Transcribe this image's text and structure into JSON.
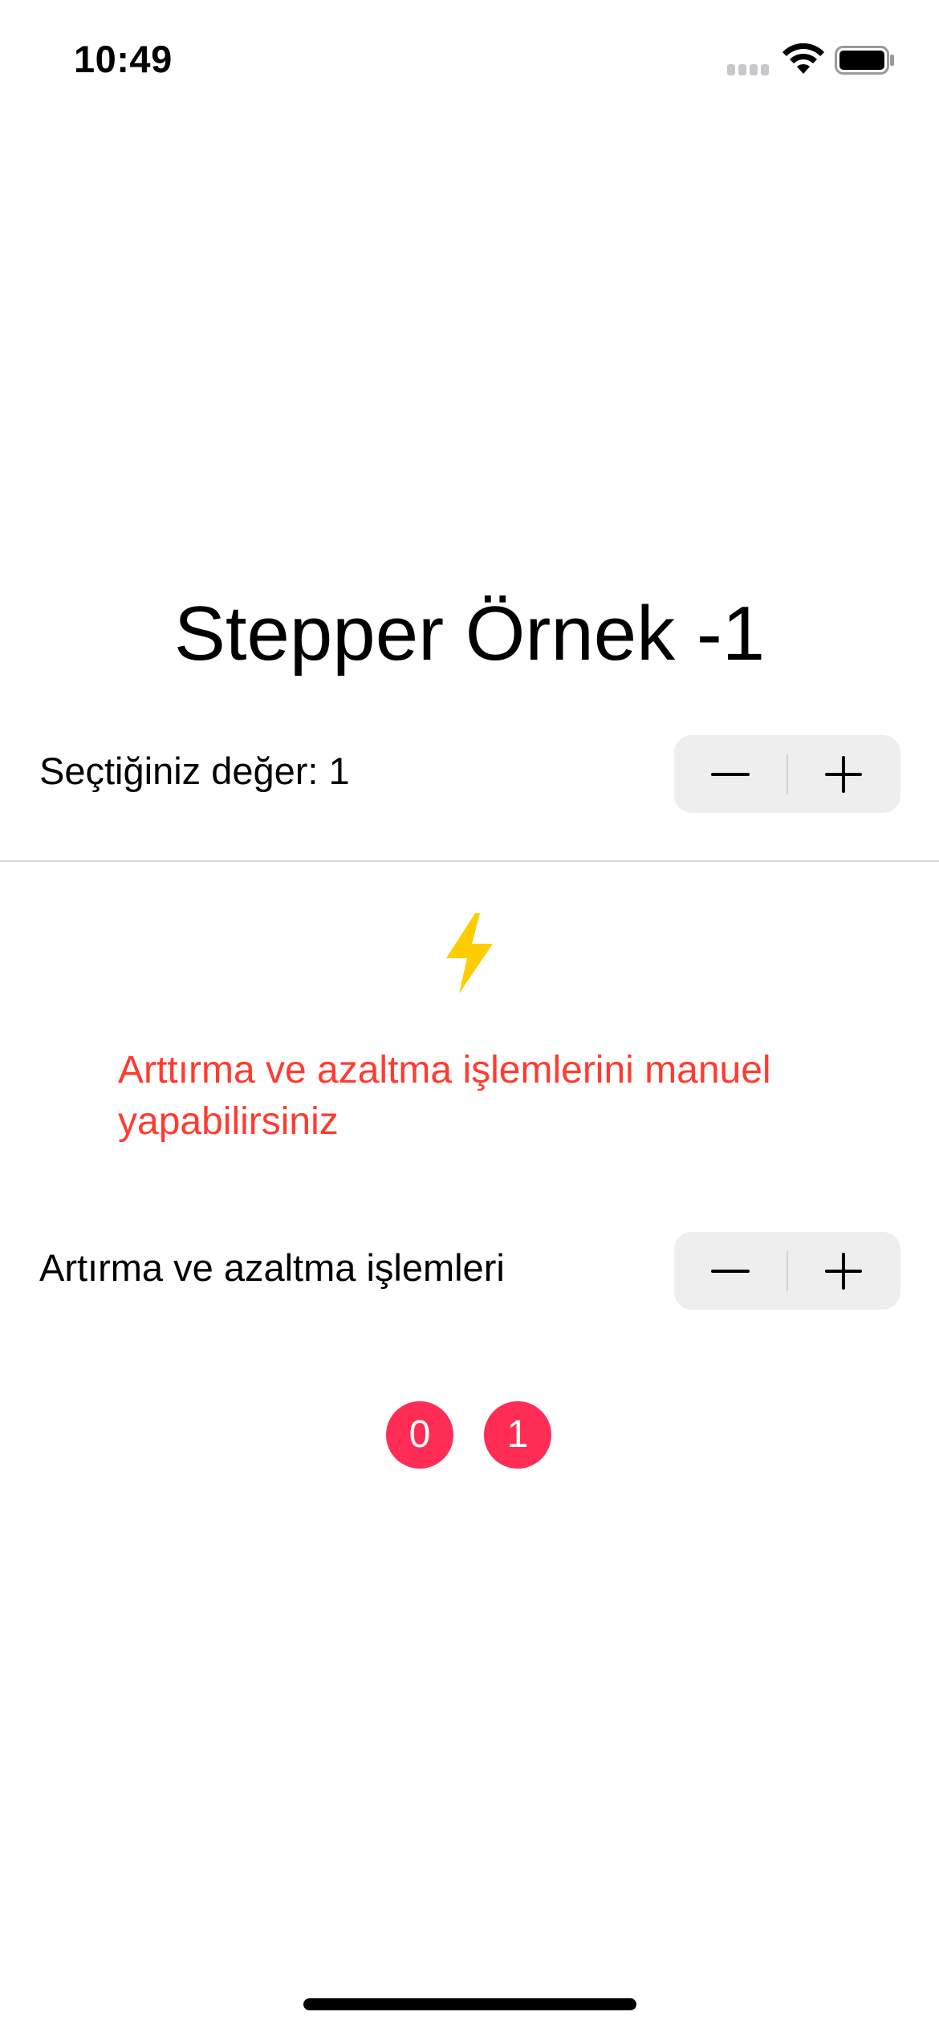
{
  "status_bar": {
    "time": "10:49",
    "icons": [
      "cellular-signal-icon",
      "wifi-icon",
      "battery-icon"
    ]
  },
  "title": "Stepper Örnek -1",
  "stepper_one": {
    "label": "Seçtiğiniz değer: 1",
    "value": 1
  },
  "info_icon": "lightning-bolt-icon",
  "manual_text": "Arttırma ve azaltma işlemlerini manuel yapabilirsiniz",
  "stepper_two": {
    "label": "Artırma ve azaltma işlemleri"
  },
  "counters": [
    "0",
    "1"
  ],
  "colors": {
    "accent_red": "#ff3b30",
    "badge_pink": "#ff2d55",
    "bolt_yellow": "#ffcc00",
    "stepper_bg": "#eeeeef"
  }
}
